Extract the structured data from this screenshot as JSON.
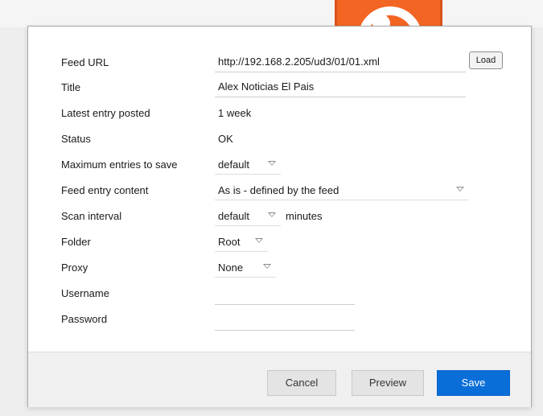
{
  "background": {
    "logo": "rss-feed-icon"
  },
  "form": {
    "feed_url": {
      "label": "Feed URL",
      "value": "http://192.168.2.205/ud3/01/01.xml",
      "load_button": "Load"
    },
    "title": {
      "label": "Title",
      "value": "Alex Noticias El Pais"
    },
    "latest_entry": {
      "label": "Latest entry posted",
      "value": "1 week"
    },
    "status": {
      "label": "Status",
      "value": "OK"
    },
    "max_entries": {
      "label": "Maximum entries to save",
      "selected": "default"
    },
    "entry_content": {
      "label": "Feed entry content",
      "selected": "As is - defined by the feed"
    },
    "scan_interval": {
      "label": "Scan interval",
      "selected": "default",
      "suffix": "minutes"
    },
    "folder": {
      "label": "Folder",
      "selected": "Root"
    },
    "proxy": {
      "label": "Proxy",
      "selected": "None"
    },
    "username": {
      "label": "Username",
      "value": ""
    },
    "password": {
      "label": "Password",
      "value": ""
    }
  },
  "footer": {
    "cancel": "Cancel",
    "preview": "Preview",
    "save": "Save"
  },
  "colors": {
    "primary_button": "#0a6ed9",
    "rss_orange": "#f26522"
  }
}
